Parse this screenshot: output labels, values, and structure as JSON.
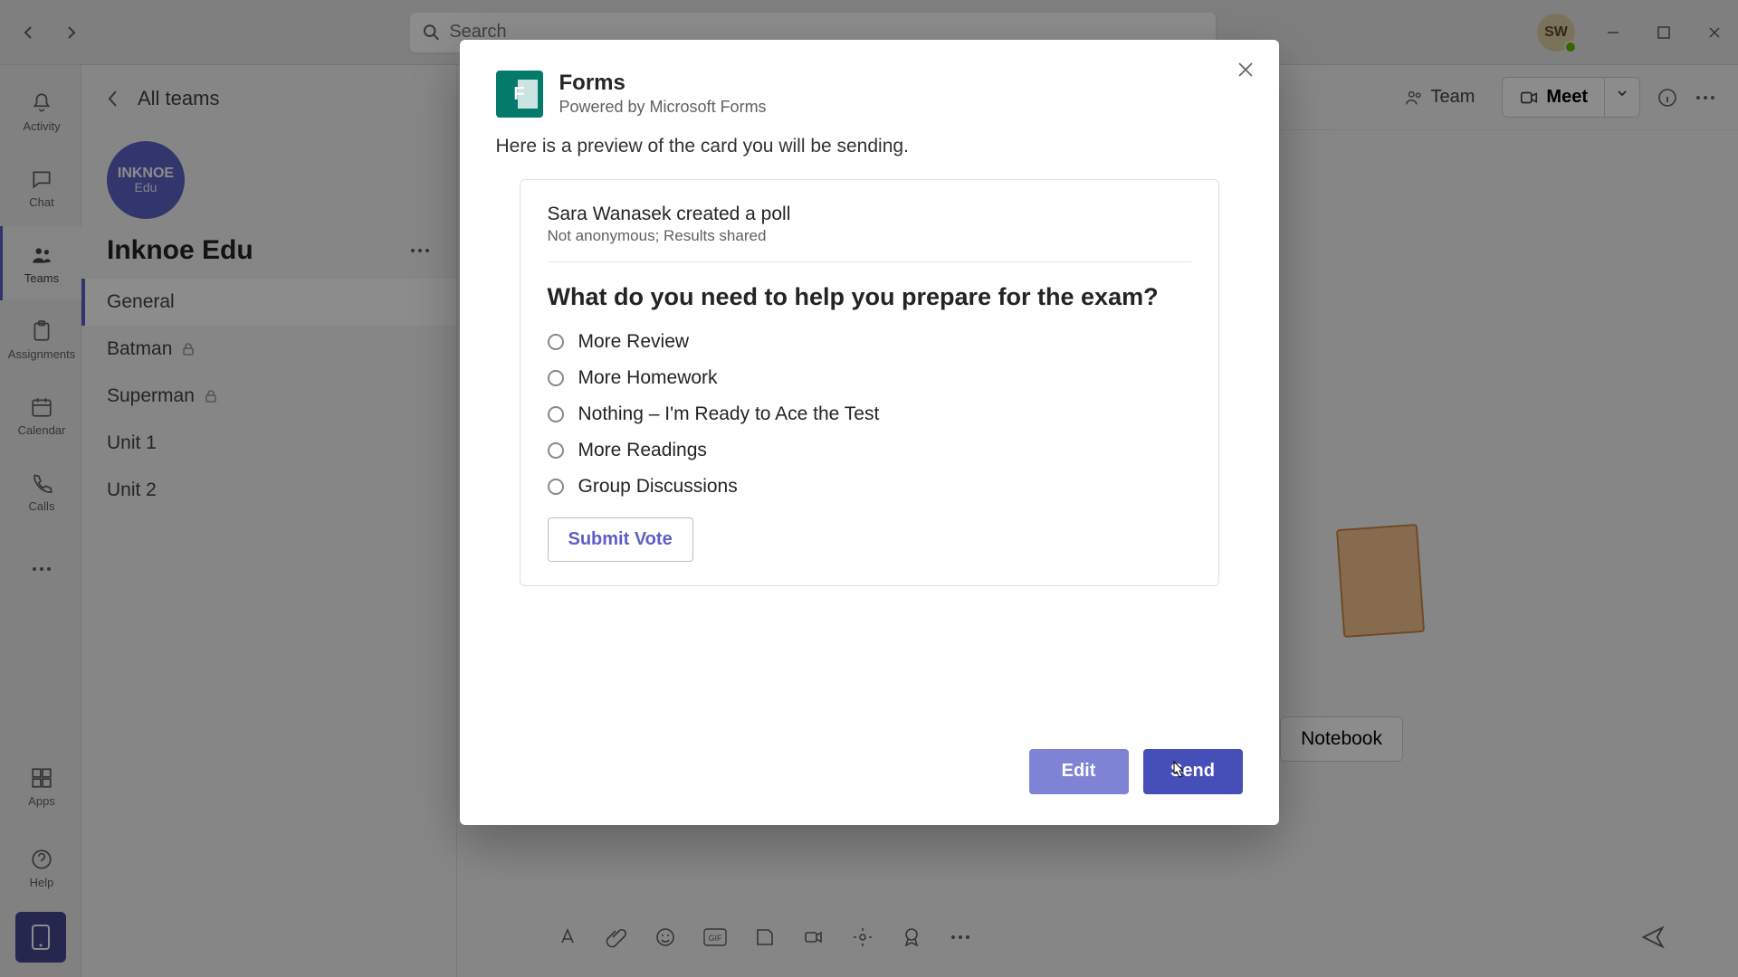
{
  "titlebar": {
    "search_placeholder": "Search",
    "avatar_initials": "SW"
  },
  "rail": {
    "items": [
      {
        "label": "Activity"
      },
      {
        "label": "Chat"
      },
      {
        "label": "Teams"
      },
      {
        "label": "Assignments"
      },
      {
        "label": "Calendar"
      },
      {
        "label": "Calls"
      },
      {
        "label": "Apps"
      },
      {
        "label": "Help"
      }
    ]
  },
  "sidebar": {
    "all_teams": "All teams",
    "team_logo_top": "INKNOE",
    "team_logo_bottom": "Edu",
    "team_name": "Inknoe Edu",
    "channels": [
      {
        "label": "General",
        "active": true,
        "locked": false
      },
      {
        "label": "Batman",
        "active": false,
        "locked": true
      },
      {
        "label": "Superman",
        "active": false,
        "locked": true
      },
      {
        "label": "Unit 1",
        "active": false,
        "locked": false
      },
      {
        "label": "Unit 2",
        "active": false,
        "locked": false
      }
    ]
  },
  "header": {
    "team_btn": "Team",
    "meet_btn": "Meet"
  },
  "main": {
    "notebook_btn": "Notebook"
  },
  "modal": {
    "title": "Forms",
    "subtitle": "Powered by Microsoft Forms",
    "preview_text": "Here is a preview of the card you will be sending.",
    "card": {
      "author_line": "Sara Wanasek created a poll",
      "meta": "Not anonymous; Results shared",
      "question": "What do you need to help you prepare for the exam?",
      "options": [
        "More Review",
        "More Homework",
        "Nothing – I'm Ready to Ace the Test",
        "More Readings",
        "Group Discussions"
      ],
      "submit": "Submit Vote"
    },
    "edit_btn": "Edit",
    "send_btn": "Send"
  }
}
